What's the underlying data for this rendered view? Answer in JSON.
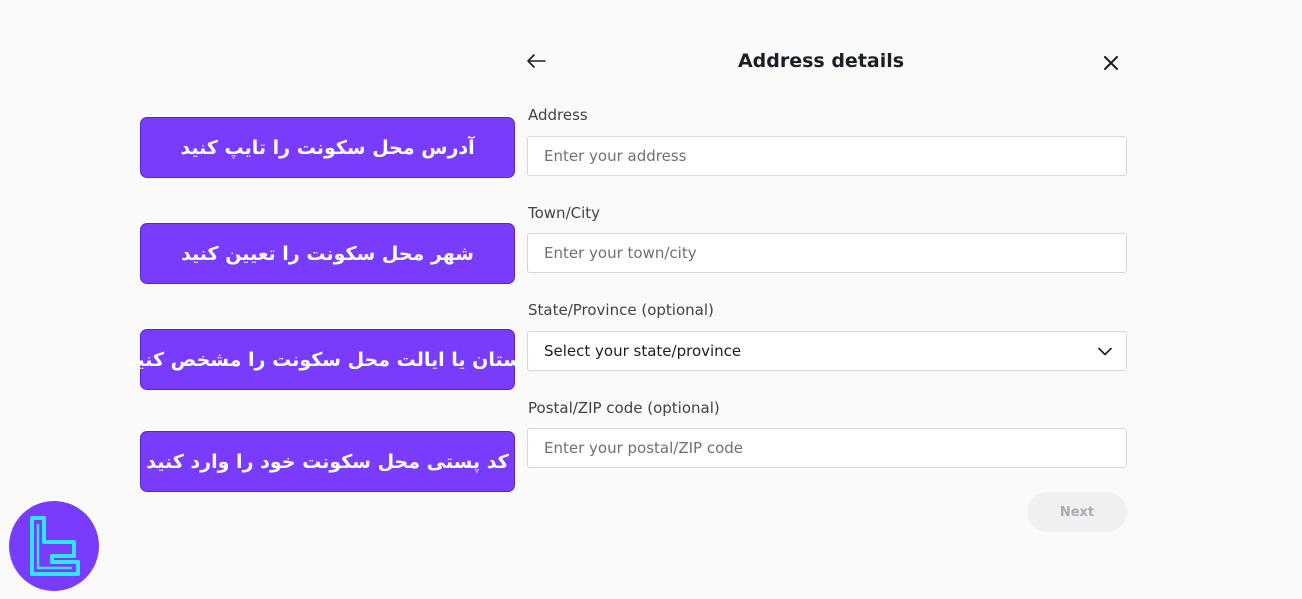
{
  "header": {
    "title": "Address details",
    "back_icon": "arrow-left-icon",
    "close_icon": "close-icon"
  },
  "form": {
    "address": {
      "label": "Address",
      "placeholder": "Enter your address",
      "value": ""
    },
    "city": {
      "label": "Town/City",
      "placeholder": "Enter your town/city",
      "value": ""
    },
    "state": {
      "label": "State/Province (optional)",
      "selected": "Select your state/province",
      "icon": "chevron-down-icon"
    },
    "postal": {
      "label": "Postal/ZIP code (optional)",
      "placeholder": "Enter your postal/ZIP code",
      "value": ""
    },
    "next_label": "Next"
  },
  "callouts": [
    "آدرس محل سکونت را تایپ کنید",
    "شهر محل سکونت را تعیین کنید",
    "استان یا ایالت محل سکونت را مشخص کنید",
    "کد پستی محل سکونت خود را وارد کنید"
  ],
  "colors": {
    "callout_bg": "#7a3cfc",
    "logo_bg": "#7a3cfc",
    "logo_fg": "#2fe6f5",
    "next_bg": "#eff0f2",
    "next_text": "#a9adb3"
  }
}
